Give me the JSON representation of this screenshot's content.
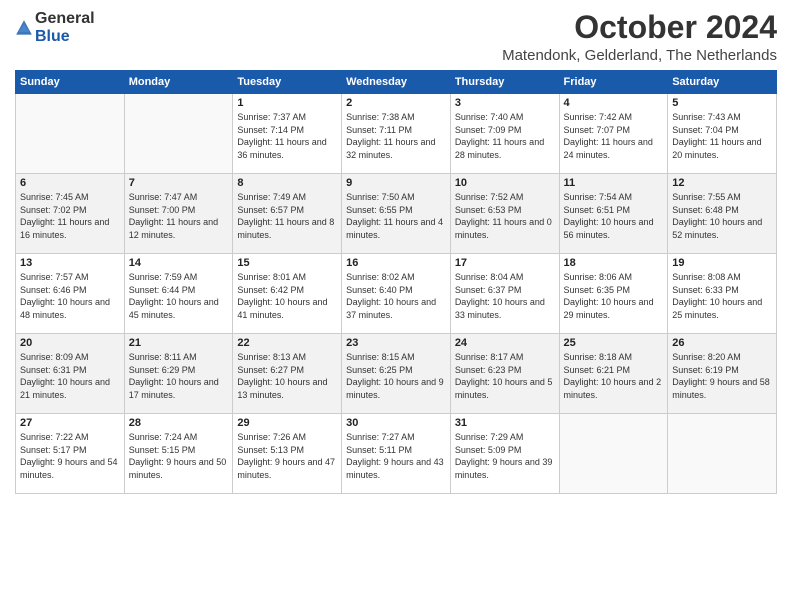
{
  "logo": {
    "general": "General",
    "blue": "Blue"
  },
  "header": {
    "month": "October 2024",
    "location": "Matendonk, Gelderland, The Netherlands"
  },
  "days_of_week": [
    "Sunday",
    "Monday",
    "Tuesday",
    "Wednesday",
    "Thursday",
    "Friday",
    "Saturday"
  ],
  "weeks": [
    {
      "days": [
        {
          "empty": true
        },
        {
          "empty": true
        },
        {
          "date": "1",
          "sunrise": "Sunrise: 7:37 AM",
          "sunset": "Sunset: 7:14 PM",
          "daylight": "Daylight: 11 hours and 36 minutes."
        },
        {
          "date": "2",
          "sunrise": "Sunrise: 7:38 AM",
          "sunset": "Sunset: 7:11 PM",
          "daylight": "Daylight: 11 hours and 32 minutes."
        },
        {
          "date": "3",
          "sunrise": "Sunrise: 7:40 AM",
          "sunset": "Sunset: 7:09 PM",
          "daylight": "Daylight: 11 hours and 28 minutes."
        },
        {
          "date": "4",
          "sunrise": "Sunrise: 7:42 AM",
          "sunset": "Sunset: 7:07 PM",
          "daylight": "Daylight: 11 hours and 24 minutes."
        },
        {
          "date": "5",
          "sunrise": "Sunrise: 7:43 AM",
          "sunset": "Sunset: 7:04 PM",
          "daylight": "Daylight: 11 hours and 20 minutes."
        }
      ]
    },
    {
      "days": [
        {
          "date": "6",
          "sunrise": "Sunrise: 7:45 AM",
          "sunset": "Sunset: 7:02 PM",
          "daylight": "Daylight: 11 hours and 16 minutes."
        },
        {
          "date": "7",
          "sunrise": "Sunrise: 7:47 AM",
          "sunset": "Sunset: 7:00 PM",
          "daylight": "Daylight: 11 hours and 12 minutes."
        },
        {
          "date": "8",
          "sunrise": "Sunrise: 7:49 AM",
          "sunset": "Sunset: 6:57 PM",
          "daylight": "Daylight: 11 hours and 8 minutes."
        },
        {
          "date": "9",
          "sunrise": "Sunrise: 7:50 AM",
          "sunset": "Sunset: 6:55 PM",
          "daylight": "Daylight: 11 hours and 4 minutes."
        },
        {
          "date": "10",
          "sunrise": "Sunrise: 7:52 AM",
          "sunset": "Sunset: 6:53 PM",
          "daylight": "Daylight: 11 hours and 0 minutes."
        },
        {
          "date": "11",
          "sunrise": "Sunrise: 7:54 AM",
          "sunset": "Sunset: 6:51 PM",
          "daylight": "Daylight: 10 hours and 56 minutes."
        },
        {
          "date": "12",
          "sunrise": "Sunrise: 7:55 AM",
          "sunset": "Sunset: 6:48 PM",
          "daylight": "Daylight: 10 hours and 52 minutes."
        }
      ]
    },
    {
      "days": [
        {
          "date": "13",
          "sunrise": "Sunrise: 7:57 AM",
          "sunset": "Sunset: 6:46 PM",
          "daylight": "Daylight: 10 hours and 48 minutes."
        },
        {
          "date": "14",
          "sunrise": "Sunrise: 7:59 AM",
          "sunset": "Sunset: 6:44 PM",
          "daylight": "Daylight: 10 hours and 45 minutes."
        },
        {
          "date": "15",
          "sunrise": "Sunrise: 8:01 AM",
          "sunset": "Sunset: 6:42 PM",
          "daylight": "Daylight: 10 hours and 41 minutes."
        },
        {
          "date": "16",
          "sunrise": "Sunrise: 8:02 AM",
          "sunset": "Sunset: 6:40 PM",
          "daylight": "Daylight: 10 hours and 37 minutes."
        },
        {
          "date": "17",
          "sunrise": "Sunrise: 8:04 AM",
          "sunset": "Sunset: 6:37 PM",
          "daylight": "Daylight: 10 hours and 33 minutes."
        },
        {
          "date": "18",
          "sunrise": "Sunrise: 8:06 AM",
          "sunset": "Sunset: 6:35 PM",
          "daylight": "Daylight: 10 hours and 29 minutes."
        },
        {
          "date": "19",
          "sunrise": "Sunrise: 8:08 AM",
          "sunset": "Sunset: 6:33 PM",
          "daylight": "Daylight: 10 hours and 25 minutes."
        }
      ]
    },
    {
      "days": [
        {
          "date": "20",
          "sunrise": "Sunrise: 8:09 AM",
          "sunset": "Sunset: 6:31 PM",
          "daylight": "Daylight: 10 hours and 21 minutes."
        },
        {
          "date": "21",
          "sunrise": "Sunrise: 8:11 AM",
          "sunset": "Sunset: 6:29 PM",
          "daylight": "Daylight: 10 hours and 17 minutes."
        },
        {
          "date": "22",
          "sunrise": "Sunrise: 8:13 AM",
          "sunset": "Sunset: 6:27 PM",
          "daylight": "Daylight: 10 hours and 13 minutes."
        },
        {
          "date": "23",
          "sunrise": "Sunrise: 8:15 AM",
          "sunset": "Sunset: 6:25 PM",
          "daylight": "Daylight: 10 hours and 9 minutes."
        },
        {
          "date": "24",
          "sunrise": "Sunrise: 8:17 AM",
          "sunset": "Sunset: 6:23 PM",
          "daylight": "Daylight: 10 hours and 5 minutes."
        },
        {
          "date": "25",
          "sunrise": "Sunrise: 8:18 AM",
          "sunset": "Sunset: 6:21 PM",
          "daylight": "Daylight: 10 hours and 2 minutes."
        },
        {
          "date": "26",
          "sunrise": "Sunrise: 8:20 AM",
          "sunset": "Sunset: 6:19 PM",
          "daylight": "Daylight: 9 hours and 58 minutes."
        }
      ]
    },
    {
      "days": [
        {
          "date": "27",
          "sunrise": "Sunrise: 7:22 AM",
          "sunset": "Sunset: 5:17 PM",
          "daylight": "Daylight: 9 hours and 54 minutes."
        },
        {
          "date": "28",
          "sunrise": "Sunrise: 7:24 AM",
          "sunset": "Sunset: 5:15 PM",
          "daylight": "Daylight: 9 hours and 50 minutes."
        },
        {
          "date": "29",
          "sunrise": "Sunrise: 7:26 AM",
          "sunset": "Sunset: 5:13 PM",
          "daylight": "Daylight: 9 hours and 47 minutes."
        },
        {
          "date": "30",
          "sunrise": "Sunrise: 7:27 AM",
          "sunset": "Sunset: 5:11 PM",
          "daylight": "Daylight: 9 hours and 43 minutes."
        },
        {
          "date": "31",
          "sunrise": "Sunrise: 7:29 AM",
          "sunset": "Sunset: 5:09 PM",
          "daylight": "Daylight: 9 hours and 39 minutes."
        },
        {
          "empty": true
        },
        {
          "empty": true
        }
      ]
    }
  ]
}
